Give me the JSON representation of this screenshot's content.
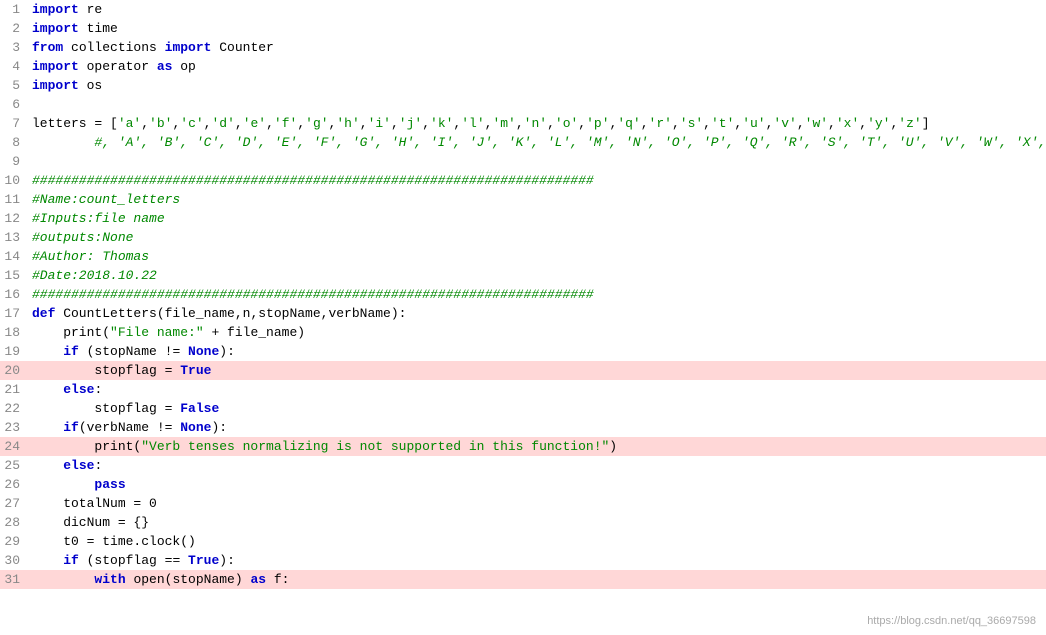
{
  "lines": [
    {
      "num": 1,
      "highlighted": false,
      "tokens": [
        {
          "t": "import re",
          "cls": ""
        }
      ]
    },
    {
      "num": 2,
      "highlighted": false,
      "tokens": [
        {
          "t": "import time",
          "cls": ""
        }
      ]
    },
    {
      "num": 3,
      "highlighted": false,
      "tokens": [
        {
          "t": "from collections import Counter",
          "cls": ""
        }
      ]
    },
    {
      "num": 4,
      "highlighted": false,
      "tokens": [
        {
          "t": "import operator as op",
          "cls": ""
        }
      ]
    },
    {
      "num": 5,
      "highlighted": false,
      "tokens": [
        {
          "t": "import os",
          "cls": ""
        }
      ]
    },
    {
      "num": 6,
      "highlighted": false,
      "tokens": [
        {
          "t": "",
          "cls": ""
        }
      ]
    },
    {
      "num": 7,
      "highlighted": false,
      "tokens": [
        {
          "t": "letters = ['a','b','c','d','e','f','g','h','i','j','k','l','m','n','o','p','q','r','s','t','u','v','w','x','y','z']",
          "cls": ""
        }
      ]
    },
    {
      "num": 8,
      "highlighted": false,
      "tokens": [
        {
          "t": "        #, 'A', 'B', 'C', 'D', 'E', 'F', 'G', 'H', 'I', 'J', 'K', 'L', 'M', 'N', 'O', 'P', 'Q', 'R', 'S', 'T', 'U', 'V', 'W', 'X', 'Y', 'Z']",
          "cls": "comment"
        }
      ]
    },
    {
      "num": 9,
      "highlighted": false,
      "tokens": [
        {
          "t": "",
          "cls": ""
        }
      ]
    },
    {
      "num": 10,
      "highlighted": false,
      "tokens": [
        {
          "t": "########################################################################",
          "cls": "comment"
        }
      ]
    },
    {
      "num": 11,
      "highlighted": false,
      "tokens": [
        {
          "t": "#Name:count_letters",
          "cls": "comment"
        }
      ]
    },
    {
      "num": 12,
      "highlighted": false,
      "tokens": [
        {
          "t": "#Inputs:file name",
          "cls": "comment"
        }
      ]
    },
    {
      "num": 13,
      "highlighted": false,
      "tokens": [
        {
          "t": "#outputs:None",
          "cls": "comment"
        }
      ]
    },
    {
      "num": 14,
      "highlighted": false,
      "tokens": [
        {
          "t": "#Author: Thomas",
          "cls": "comment"
        }
      ]
    },
    {
      "num": 15,
      "highlighted": false,
      "tokens": [
        {
          "t": "#Date:2018.10.22",
          "cls": "comment"
        }
      ]
    },
    {
      "num": 16,
      "highlighted": false,
      "tokens": [
        {
          "t": "########################################################################",
          "cls": "comment"
        }
      ]
    },
    {
      "num": 17,
      "highlighted": false,
      "tokens": [
        {
          "t": "def CountLetters(file_name,n,stopName,verbName):",
          "cls": ""
        }
      ]
    },
    {
      "num": 18,
      "highlighted": false,
      "tokens": [
        {
          "t": "    print(\"File name:\" + file_name)",
          "cls": ""
        }
      ]
    },
    {
      "num": 19,
      "highlighted": false,
      "tokens": [
        {
          "t": "    if (stopName != None):",
          "cls": ""
        }
      ]
    },
    {
      "num": 20,
      "highlighted": true,
      "tokens": [
        {
          "t": "        stopflag = True",
          "cls": ""
        }
      ]
    },
    {
      "num": 21,
      "highlighted": false,
      "tokens": [
        {
          "t": "    else:",
          "cls": ""
        }
      ]
    },
    {
      "num": 22,
      "highlighted": false,
      "tokens": [
        {
          "t": "        stopflag = False",
          "cls": ""
        }
      ]
    },
    {
      "num": 23,
      "highlighted": false,
      "tokens": [
        {
          "t": "    if(verbName != None):",
          "cls": ""
        }
      ]
    },
    {
      "num": 24,
      "highlighted": true,
      "tokens": [
        {
          "t": "        print(\"Verb tenses normalizing is not supported in this function!\")",
          "cls": ""
        }
      ]
    },
    {
      "num": 25,
      "highlighted": false,
      "tokens": [
        {
          "t": "    else:",
          "cls": ""
        }
      ]
    },
    {
      "num": 26,
      "highlighted": false,
      "tokens": [
        {
          "t": "        pass",
          "cls": ""
        }
      ]
    },
    {
      "num": 27,
      "highlighted": false,
      "tokens": [
        {
          "t": "    totalNum = 0",
          "cls": ""
        }
      ]
    },
    {
      "num": 28,
      "highlighted": false,
      "tokens": [
        {
          "t": "    dicNum = {}",
          "cls": ""
        }
      ]
    },
    {
      "num": 29,
      "highlighted": false,
      "tokens": [
        {
          "t": "    t0 = time.clock()",
          "cls": ""
        }
      ]
    },
    {
      "num": 30,
      "highlighted": false,
      "tokens": [
        {
          "t": "    if (stopflag == True):",
          "cls": ""
        }
      ]
    },
    {
      "num": 31,
      "highlighted": true,
      "tokens": [
        {
          "t": "        with open(stopName) as f:",
          "cls": ""
        }
      ]
    }
  ],
  "watermark": "https://blog.csdn.net/qq_36697598"
}
